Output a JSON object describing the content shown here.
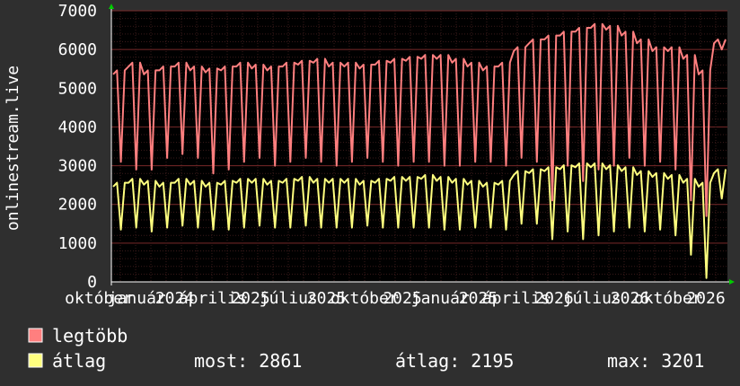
{
  "chart_data": {
    "type": "line",
    "ylabel": "onlinestream.live",
    "ylim": [
      0,
      7000
    ],
    "y_ticks": [
      "0",
      "1000",
      "2000",
      "3000",
      "4000",
      "5000",
      "6000",
      "7000"
    ],
    "x_tick_labels": [
      "október",
      "január",
      "2024",
      "április",
      "2025",
      "július",
      "2025",
      "október",
      "2025",
      "január",
      "2025",
      "április",
      "2026",
      "július",
      "2026",
      "október",
      "2026"
    ],
    "grid": true,
    "colors": {
      "background": "#2f2f2f",
      "plot": "#000000",
      "grid": "#5a2020",
      "axis": "#ffffff",
      "arrow": "#00cc00"
    },
    "series": [
      {
        "name": "legtöbb",
        "color": "#ff7f7f",
        "high": [
          5400,
          5600,
          5400,
          5500,
          5600,
          5500,
          5450,
          5500,
          5600,
          5550,
          5500,
          5600,
          5650,
          5700,
          5600,
          5600,
          5550,
          5650,
          5700,
          5750,
          5800,
          5800,
          5700,
          5600,
          5500,
          5600,
          6000,
          6200,
          6300,
          6400,
          6500,
          6600,
          6550,
          6400,
          6200,
          6000,
          6000,
          5800,
          5400,
          6200
        ],
        "low": [
          3100,
          2900,
          2900,
          3200,
          3300,
          3200,
          2800,
          2900,
          3100,
          3200,
          3000,
          3100,
          3200,
          3100,
          3000,
          3100,
          3200,
          3100,
          3000,
          3100,
          3100,
          3000,
          3000,
          3100,
          3100,
          3000,
          3200,
          3100,
          2100,
          3000,
          2600,
          2900,
          3000,
          3200,
          3000,
          3100,
          2900,
          2100,
          1700,
          6000
        ]
      },
      {
        "name": "átlag",
        "color": "#ffff7f",
        "high": [
          2500,
          2600,
          2550,
          2500,
          2600,
          2550,
          2500,
          2550,
          2600,
          2600,
          2550,
          2600,
          2650,
          2600,
          2600,
          2600,
          2550,
          2600,
          2650,
          2650,
          2700,
          2650,
          2600,
          2550,
          2500,
          2550,
          2800,
          2850,
          2900,
          2950,
          3000,
          3000,
          2950,
          2900,
          2800,
          2750,
          2700,
          2600,
          2500,
          2850
        ],
        "low": [
          1350,
          1400,
          1300,
          1400,
          1450,
          1400,
          1350,
          1350,
          1400,
          1450,
          1400,
          1400,
          1450,
          1400,
          1400,
          1400,
          1450,
          1400,
          1400,
          1400,
          1400,
          1350,
          1350,
          1400,
          1400,
          1350,
          1500,
          1500,
          1100,
          1300,
          1100,
          1200,
          1300,
          1400,
          1300,
          1350,
          1200,
          700,
          100,
          2150
        ]
      }
    ]
  },
  "legend": {
    "items": [
      {
        "label": "legtöbb",
        "color": "#ff7f7f"
      },
      {
        "label": "átlag",
        "color": "#ffff7f"
      }
    ],
    "stats": {
      "now": "most: 2861",
      "avg": "átlag: 2195",
      "max": "max: 3201"
    }
  }
}
